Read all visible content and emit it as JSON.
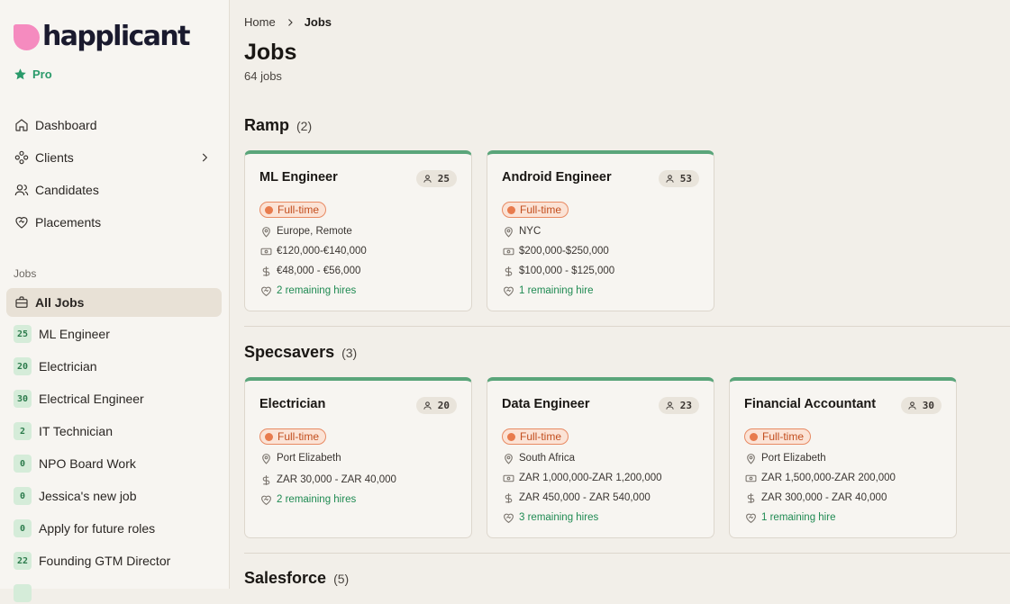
{
  "brand": {
    "name": "happlicant",
    "plan": "Pro",
    "accent": "#f58bbf",
    "green": "#2a9a6a"
  },
  "nav": [
    {
      "label": "Dashboard",
      "icon": "home-icon"
    },
    {
      "label": "Clients",
      "icon": "clients-icon"
    },
    {
      "label": "Candidates",
      "icon": "users-icon"
    },
    {
      "label": "Placements",
      "icon": "heart-handshake-icon"
    }
  ],
  "sidebar_jobs": {
    "section_label": "Jobs",
    "all_label": "All Jobs",
    "items": [
      {
        "count": "25",
        "label": "ML Engineer"
      },
      {
        "count": "20",
        "label": "Electrician"
      },
      {
        "count": "30",
        "label": "Electrical Engineer"
      },
      {
        "count": "2",
        "label": "IT Technician"
      },
      {
        "count": "0",
        "label": "NPO Board Work"
      },
      {
        "count": "0",
        "label": "Jessica's new job"
      },
      {
        "count": "0",
        "label": "Apply for future roles"
      },
      {
        "count": "22",
        "label": "Founding GTM Director"
      }
    ]
  },
  "breadcrumb": {
    "home": "Home",
    "current": "Jobs"
  },
  "page": {
    "title": "Jobs",
    "count": "64 jobs"
  },
  "groups": [
    {
      "name": "Ramp",
      "count": "(2)",
      "jobs": [
        {
          "title": "ML Engineer",
          "candidates": "25",
          "type": "Full-time",
          "location": "Europe, Remote",
          "budget": "€120,000-€140,000",
          "salary": "€48,000 - €56,000",
          "hires": "2 remaining hires"
        },
        {
          "title": "Android Engineer",
          "candidates": "53",
          "type": "Full-time",
          "location": "NYC",
          "budget": "$200,000-$250,000",
          "salary": "$100,000 - $125,000",
          "hires": "1 remaining hire"
        }
      ]
    },
    {
      "name": "Specsavers",
      "count": "(3)",
      "jobs": [
        {
          "title": "Electrician",
          "candidates": "20",
          "type": "Full-time",
          "location": "Port Elizabeth",
          "salary": "ZAR 30,000 - ZAR 40,000",
          "hires": "2 remaining hires"
        },
        {
          "title": "Data Engineer",
          "candidates": "23",
          "type": "Full-time",
          "location": "South Africa",
          "budget": "ZAR 1,000,000-ZAR 1,200,000",
          "salary": "ZAR 450,000 - ZAR 540,000",
          "hires": "3 remaining hires"
        },
        {
          "title": "Financial Accountant",
          "candidates": "30",
          "type": "Full-time",
          "location": "Port Elizabeth",
          "budget": "ZAR 1,500,000-ZAR 200,000",
          "salary": "ZAR 300,000 - ZAR 40,000",
          "hires": "1 remaining hire"
        }
      ]
    },
    {
      "name": "Salesforce",
      "count": "(5)"
    }
  ]
}
